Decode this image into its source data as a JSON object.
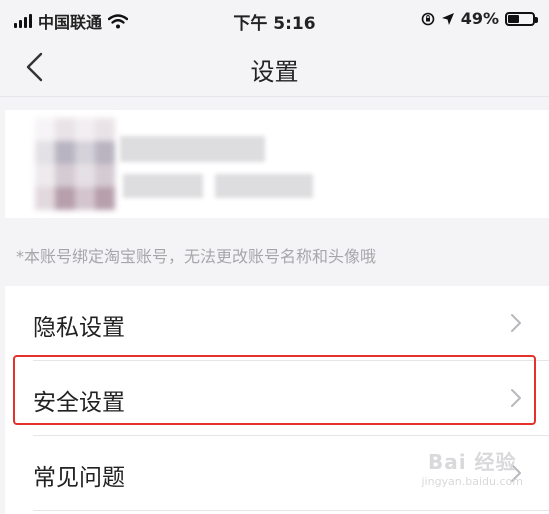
{
  "status_bar": {
    "carrier": "中国联通",
    "time": "下午 5:16",
    "battery_text": "49%",
    "battery_level": 0.49,
    "icons": [
      "signal-icon",
      "wifi-icon",
      "orientation-lock-icon",
      "location-arrow-icon",
      "battery-icon"
    ]
  },
  "nav": {
    "title": "设置",
    "back_icon": "chevron-left-icon"
  },
  "profile": {
    "notice": "*本账号绑定淘宝账号，无法更改账号名称和头像哦"
  },
  "menu": {
    "items": [
      {
        "label": "隐私设置",
        "icon": "chevron-right-icon"
      },
      {
        "label": "安全设置",
        "icon": "chevron-right-icon",
        "highlighted": true
      },
      {
        "label": "常见问题",
        "icon": "chevron-right-icon"
      }
    ]
  },
  "watermark": {
    "brand": "Bai 经验",
    "url": "jingyan.baidu.com"
  },
  "colors": {
    "highlight": "#e3322b",
    "background": "#f4f4f6",
    "muted_text": "#a7a7ab"
  }
}
